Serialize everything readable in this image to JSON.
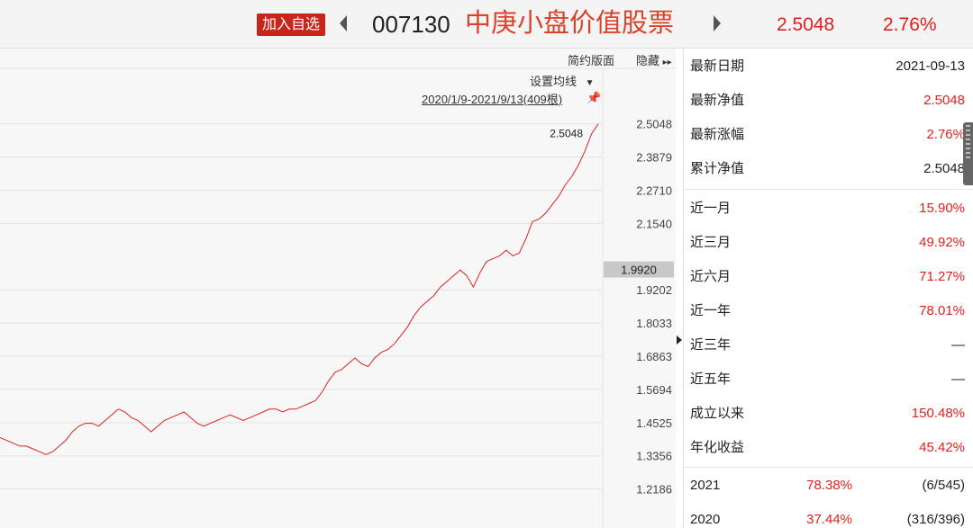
{
  "header": {
    "add_button": "加入自选",
    "code": "007130",
    "name": "中庚小盘价值股票",
    "nav": "2.5048",
    "change": "2.76%"
  },
  "toolbar": {
    "simple": "简约版面",
    "hide": "隐藏",
    "ma_setting": "设置均线",
    "range": "2020/1/9-2021/9/13(409根)",
    "last_value_label": "2.5048"
  },
  "chart_data": {
    "type": "line",
    "title": "",
    "xlabel": "",
    "ylabel": "",
    "yticks": [
      "2.5048",
      "2.3879",
      "2.2710",
      "2.1540",
      "1.9202",
      "1.8033",
      "1.6863",
      "1.5694",
      "1.4525",
      "1.3356",
      "1.2186"
    ],
    "crosshair_value": "1.9920",
    "ylim": [
      1.17,
      2.545
    ],
    "series": [
      {
        "name": "",
        "color": "#e02020",
        "values": [
          1.4,
          1.39,
          1.38,
          1.37,
          1.37,
          1.36,
          1.35,
          1.34,
          1.35,
          1.37,
          1.39,
          1.42,
          1.44,
          1.45,
          1.45,
          1.44,
          1.46,
          1.48,
          1.5,
          1.49,
          1.47,
          1.46,
          1.44,
          1.42,
          1.44,
          1.46,
          1.47,
          1.48,
          1.49,
          1.47,
          1.45,
          1.44,
          1.45,
          1.46,
          1.47,
          1.48,
          1.47,
          1.46,
          1.47,
          1.48,
          1.49,
          1.5,
          1.5,
          1.49,
          1.5,
          1.5,
          1.51,
          1.52,
          1.53,
          1.56,
          1.6,
          1.63,
          1.64,
          1.66,
          1.68,
          1.66,
          1.65,
          1.68,
          1.7,
          1.71,
          1.73,
          1.76,
          1.79,
          1.83,
          1.86,
          1.88,
          1.9,
          1.93,
          1.95,
          1.97,
          1.99,
          1.97,
          1.93,
          1.98,
          2.02,
          2.03,
          2.04,
          2.06,
          2.04,
          2.05,
          2.1,
          2.16,
          2.17,
          2.19,
          2.22,
          2.25,
          2.29,
          2.32,
          2.36,
          2.41,
          2.47,
          2.5048
        ]
      }
    ]
  },
  "panel": {
    "rows": [
      {
        "label": "最新日期",
        "value": "2021-09-13",
        "red": false
      },
      {
        "label": "最新净值",
        "value": "2.5048",
        "red": true
      },
      {
        "label": "最新涨幅",
        "value": "2.76%",
        "red": true
      },
      {
        "label": "累计净值",
        "value": "2.5048",
        "red": false
      },
      {
        "label": "近一月",
        "value": "15.90%",
        "red": true
      },
      {
        "label": "近三月",
        "value": "49.92%",
        "red": true
      },
      {
        "label": "近六月",
        "value": "71.27%",
        "red": true
      },
      {
        "label": "近一年",
        "value": "78.01%",
        "red": true
      },
      {
        "label": "近三年",
        "value": "—",
        "red": false
      },
      {
        "label": "近五年",
        "value": "—",
        "red": false
      },
      {
        "label": "成立以来",
        "value": "150.48%",
        "red": true
      },
      {
        "label": "年化收益",
        "value": "45.42%",
        "red": true
      }
    ],
    "years": [
      {
        "year": "2021",
        "return": "78.38%",
        "rank": "(6/545)"
      },
      {
        "year": "2020",
        "return": "37.44%",
        "rank": "(316/396)"
      }
    ]
  }
}
